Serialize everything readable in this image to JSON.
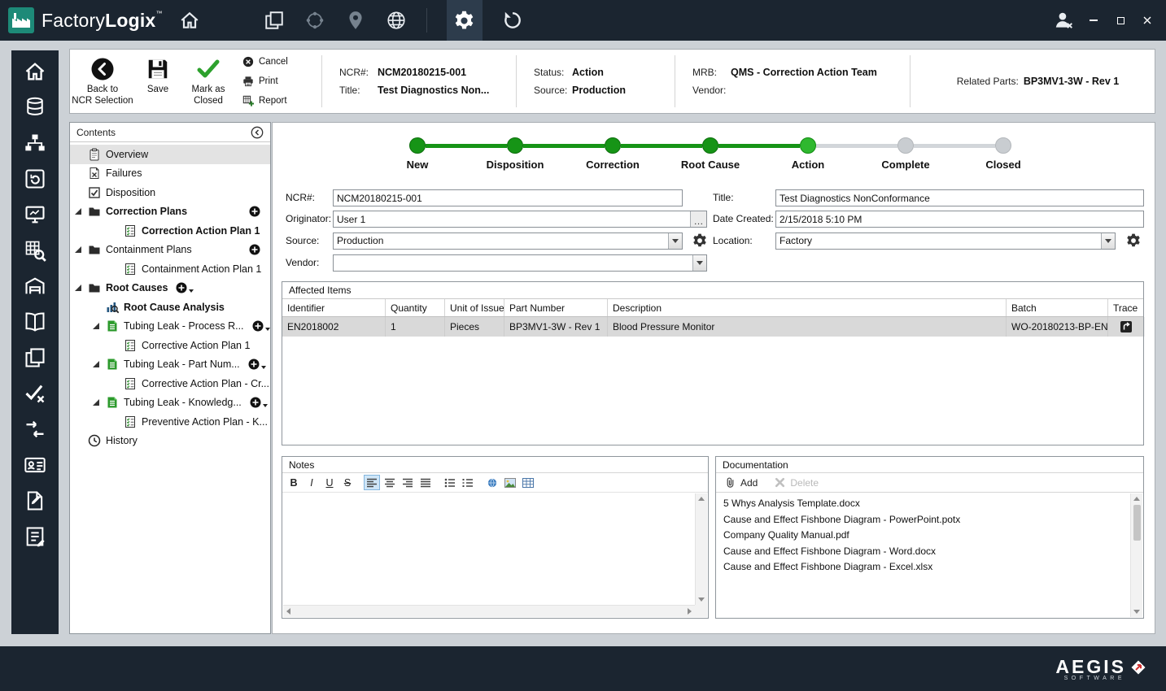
{
  "window": {
    "brand_first": "Factory",
    "brand_second": "Logix",
    "brand_tm": "™"
  },
  "toolbar": {
    "back_line1": "Back to",
    "back_line2": "NCR Selection",
    "save": "Save",
    "mark_line1": "Mark as",
    "mark_line2": "Closed",
    "cancel": "Cancel",
    "print": "Print",
    "report": "Report"
  },
  "header": {
    "ncr_label": "NCR#:",
    "ncr_value": "NCM20180215-001",
    "title_label": "Title:",
    "title_value": "Test Diagnostics Non...",
    "status_label": "Status:",
    "status_value": "Action",
    "source_label": "Source:",
    "source_value": "Production",
    "mrb_label": "MRB:",
    "mrb_value": "QMS - Correction Action Team",
    "vendor_label": "Vendor:",
    "vendor_value": "",
    "related_label": "Related Parts:",
    "related_value": "BP3MV1-3W - Rev 1"
  },
  "contents": {
    "title": "Contents",
    "items": [
      {
        "label": "Overview",
        "icon": "clipboard",
        "indent": 0,
        "selected": true
      },
      {
        "label": "Failures",
        "icon": "docx",
        "indent": 0
      },
      {
        "label": "Disposition",
        "icon": "checkboxchk",
        "indent": 0
      },
      {
        "label": "Correction Plans",
        "icon": "folder",
        "indent": 0,
        "bold": true,
        "expanded": true,
        "add": "right"
      },
      {
        "label": "Correction Action Plan 1",
        "icon": "checklist",
        "indent": 2,
        "bold": true
      },
      {
        "label": "Containment Plans",
        "icon": "folder",
        "indent": 0,
        "expanded": true,
        "add": "right"
      },
      {
        "label": "Containment Action Plan 1",
        "icon": "checklist",
        "indent": 2
      },
      {
        "label": "Root Causes",
        "icon": "folder",
        "indent": 0,
        "bold": true,
        "expanded": true,
        "add": "inline",
        "menu": true
      },
      {
        "label": "Root Cause Analysis",
        "icon": "analysis",
        "indent": 1,
        "bold": true
      },
      {
        "label": "Tubing Leak - Process R...",
        "icon": "greendoc",
        "indent": 1,
        "expanded": true,
        "add": "inline",
        "menu": true
      },
      {
        "label": "Corrective Action Plan 1",
        "icon": "checklist",
        "indent": 2
      },
      {
        "label": "Tubing Leak - Part Num...",
        "icon": "greendoc",
        "indent": 1,
        "expanded": true,
        "add": "inline",
        "menu": true
      },
      {
        "label": "Corrective Action Plan - Cr...",
        "icon": "checklist",
        "indent": 2
      },
      {
        "label": "Tubing Leak - Knowledg...",
        "icon": "greendoc",
        "indent": 1,
        "expanded": true,
        "add": "inline",
        "menu": true
      },
      {
        "label": "Preventive Action Plan - K...",
        "icon": "checklist",
        "indent": 2
      },
      {
        "label": "History",
        "icon": "clock",
        "indent": 0
      }
    ]
  },
  "stepper": {
    "steps": [
      {
        "label": "New",
        "state": "done"
      },
      {
        "label": "Disposition",
        "state": "done"
      },
      {
        "label": "Correction",
        "state": "done"
      },
      {
        "label": "Root Cause",
        "state": "done"
      },
      {
        "label": "Action",
        "state": "current"
      },
      {
        "label": "Complete",
        "state": "pending"
      },
      {
        "label": "Closed",
        "state": "pending"
      }
    ]
  },
  "form": {
    "ncr_label": "NCR#:",
    "ncr_value": "NCM20180215-001",
    "title_label": "Title:",
    "title_value": "Test Diagnostics NonConformance",
    "originator_label": "Originator:",
    "originator_value": "User 1",
    "originator_browse": "…",
    "date_label": "Date Created:",
    "date_value": "2/15/2018 5:10 PM",
    "source_label": "Source:",
    "source_value": "Production",
    "location_label": "Location:",
    "location_value": "Factory",
    "vendor_label": "Vendor:",
    "vendor_value": ""
  },
  "affected": {
    "title": "Affected Items",
    "columns": [
      "Identifier",
      "Quantity",
      "Unit of Issue",
      "Part Number",
      "Description",
      "Batch",
      "Trace"
    ],
    "rows": [
      {
        "cells": [
          "EN2018002",
          "1",
          "Pieces",
          "BP3MV1-3W - Rev 1",
          "Blood Pressure Monitor",
          "WO-20180213-BP-EN"
        ],
        "selected": true
      }
    ]
  },
  "notes": {
    "title": "Notes",
    "bold": "B",
    "italic": "I",
    "underline": "U",
    "strike": "S",
    "content": ""
  },
  "documentation": {
    "title": "Documentation",
    "add": "Add",
    "delete": "Delete",
    "files": [
      "5 Whys Analysis Template.docx",
      "Cause and Effect Fishbone Diagram - PowerPoint.potx",
      "Company Quality Manual.pdf",
      "Cause and Effect Fishbone Diagram - Word.docx",
      "Cause and Effect Fishbone Diagram - Excel.xlsx"
    ]
  },
  "footer": {
    "brand": "AEGIS",
    "sub": "SOFTWARE"
  }
}
